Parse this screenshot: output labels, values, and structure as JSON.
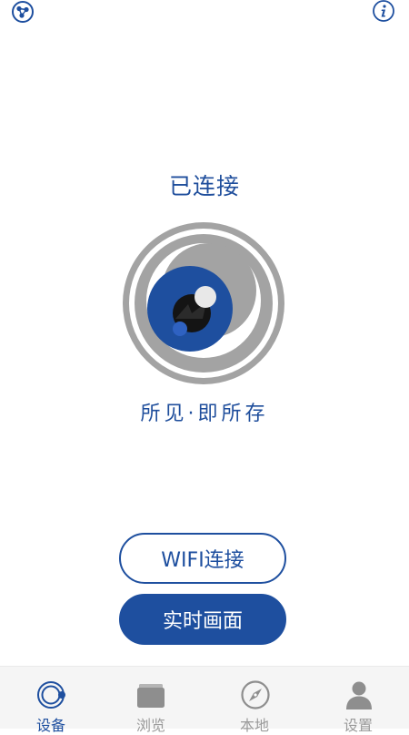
{
  "header": {
    "left_icon": "share-icon",
    "right_icon": "info-icon"
  },
  "main": {
    "status": "已连接",
    "slogan": "所见·即所存",
    "logo_icon": "camera-eye-logo"
  },
  "buttons": {
    "wifi_label": "WIFI连接",
    "live_label": "实时画面"
  },
  "tabs": [
    {
      "label": "设备",
      "icon": "device-icon",
      "active": true
    },
    {
      "label": "浏览",
      "icon": "browse-icon",
      "active": false
    },
    {
      "label": "本地",
      "icon": "compass-icon",
      "active": false
    },
    {
      "label": "设置",
      "icon": "user-icon",
      "active": false
    }
  ],
  "colors": {
    "primary": "#1e4f9f",
    "inactive": "#9a9a9a",
    "ring_gray": "#a3a3a3",
    "tab_bar_bg": "#f5f5f5"
  }
}
